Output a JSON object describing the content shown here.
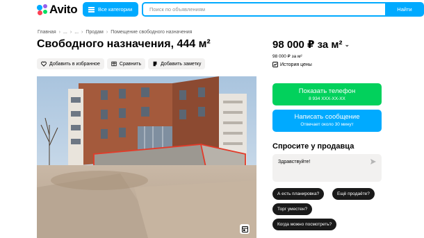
{
  "header": {
    "logo_text": "Avito",
    "categories_label": "Все категории",
    "search_placeholder": "Поиск по объявлениям",
    "search_button": "Найти"
  },
  "breadcrumb": [
    "Главная",
    "...",
    "...",
    "Продам",
    "Помещение свободного назначения"
  ],
  "title": "Свободного назначения, 444 м²",
  "actions": {
    "favorite": "Добавить в избранное",
    "compare": "Сравнить",
    "note": "Добавить заметку"
  },
  "price": {
    "main": "98 000 ₽ за м²",
    "sub": "98 000 ₽ за м²",
    "history": "История цены"
  },
  "contact": {
    "show_phone": "Показать телефон",
    "phone_masked": "8 934 XXX-XX-XX",
    "write_message": "Написать сообщение",
    "reply_time": "Отвечает около 30 минут"
  },
  "ask": {
    "title": "Спросите у продавца",
    "input_value": "Здравствуйте!",
    "chips": [
      "А есть планировка?",
      "Ещё продаёте?",
      "Торг уместен?",
      "Когда можно посмотреть?"
    ]
  },
  "colors": {
    "brand_blue": "#00aaff",
    "brand_green": "#02d15c",
    "chip_dark": "#1a1a1a"
  }
}
